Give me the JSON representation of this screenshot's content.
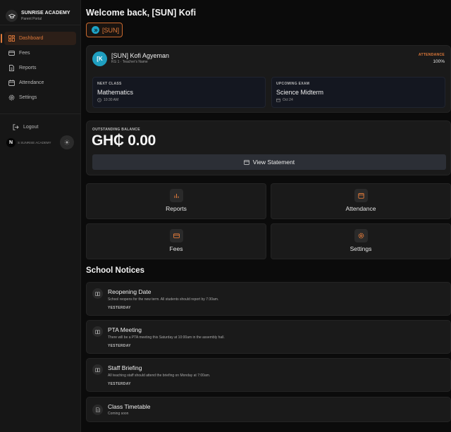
{
  "sidebar": {
    "brand_title": "SUNRISE ACADEMY",
    "brand_subtitle": "Parent Portal",
    "items": [
      {
        "label": "Dashboard",
        "icon": "dashboard-icon",
        "active": true
      },
      {
        "label": "Fees",
        "icon": "card-icon"
      },
      {
        "label": "Reports",
        "icon": "document-icon"
      },
      {
        "label": "Attendance",
        "icon": "calendar-icon"
      },
      {
        "label": "Settings",
        "icon": "gear-icon"
      }
    ],
    "logout_label": "Logout",
    "footer_logo": "N",
    "footer_text": "S SUNRISE ACADEMY"
  },
  "header": {
    "welcome": "Welcome back, [SUN] Kofi",
    "chip_label": "[SUN]"
  },
  "profile": {
    "avatar_initials": "[K",
    "name": "[SUN] Kofi Agyeman",
    "subtitle": "KG 1 · Teacher's Name",
    "attendance_label": "ATTENDANCE",
    "attendance_value": "100%",
    "next_class": {
      "label": "NEXT CLASS",
      "value": "Mathematics",
      "meta": "10:30 AM"
    },
    "upcoming_exam": {
      "label": "UPCOMING EXAM",
      "value": "Science Midterm",
      "meta": "Oct 24"
    }
  },
  "balance": {
    "label": "OUTSTANDING BALANCE",
    "value": "GH₵ 0.00",
    "button_label": "View Statement"
  },
  "quick_links": [
    {
      "label": "Reports",
      "icon": "bar-chart-icon"
    },
    {
      "label": "Attendance",
      "icon": "calendar-icon"
    },
    {
      "label": "Fees",
      "icon": "card-icon"
    },
    {
      "label": "Settings",
      "icon": "gear-icon"
    }
  ],
  "notices": {
    "title": "School Notices",
    "items": [
      {
        "title": "Reopening Date",
        "body": "School reopens for the new term. All students should report by 7:30am.",
        "time": "YESTERDAY"
      },
      {
        "title": "PTA Meeting",
        "body": "There will be a PTA meeting this Saturday at 10:00am in the assembly hall.",
        "time": "YESTERDAY"
      },
      {
        "title": "Staff Briefing",
        "body": "All teaching staff should attend the briefing on Monday at 7:00am.",
        "time": "YESTERDAY"
      },
      {
        "title": "Class Timetable",
        "body": "Coming soon"
      }
    ]
  },
  "colors": {
    "accent": "#e07a3a",
    "avatar": "#1f9fc0",
    "background": "#0b0b0b",
    "card": "#1a1a1a"
  }
}
